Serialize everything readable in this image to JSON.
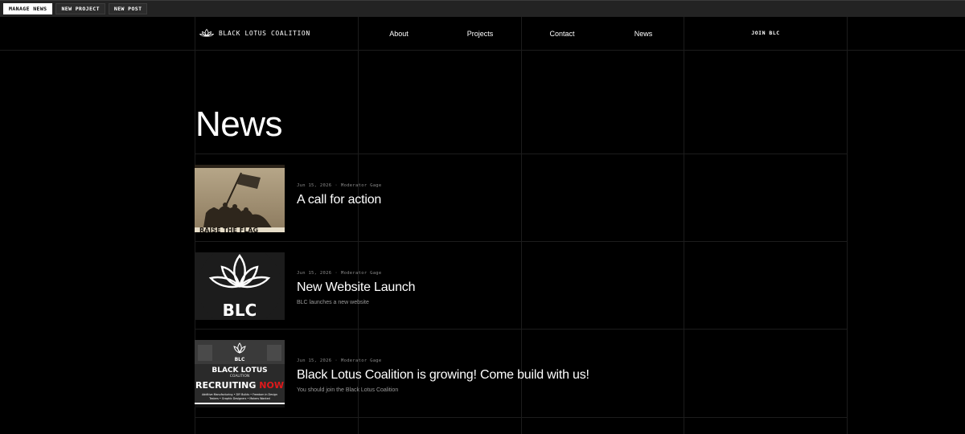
{
  "admin_bar": {
    "buttons": [
      {
        "label": "MANAGE NEWS"
      },
      {
        "label": "NEW PROJECT"
      },
      {
        "label": "NEW POST"
      }
    ]
  },
  "nav": {
    "brand": "BLACK LOTUS COALITION",
    "links": [
      {
        "label": "About"
      },
      {
        "label": "Projects"
      },
      {
        "label": "Contact"
      },
      {
        "label": "News"
      }
    ],
    "join_label": "JOIN BLC"
  },
  "page": {
    "title": "News"
  },
  "news": [
    {
      "date": "Jun 15, 2026",
      "author": "Moderator Gage",
      "title": "A call for action",
      "summary": "",
      "thumb_icon": "flag-raising-photo"
    },
    {
      "date": "Jun 15, 2026",
      "author": "Moderator Gage",
      "title": "New Website Launch",
      "summary": "BLC launches a new website",
      "thumb_icon": "blc-lotus-logo",
      "thumb_text": "BLC"
    },
    {
      "date": "Jun 15, 2026",
      "author": "Moderator Gage",
      "title": "Black Lotus Coalition is growing! Come build with us!",
      "summary": "You should join the Black Lotus Coalition",
      "thumb_icon": "recruiting-poster",
      "poster": {
        "logo_text": "BLC",
        "name_line1": "BLACK LOTUS",
        "name_line2": "COALITION",
        "recruit_white": "RECRUITING",
        "recruit_red": "NOW",
        "tagline1": "Additive Manufacturing • DIY Builds • Freedom in Design",
        "tagline2": "Testers • Graphic Designers • Makers Wanted"
      }
    }
  ]
}
